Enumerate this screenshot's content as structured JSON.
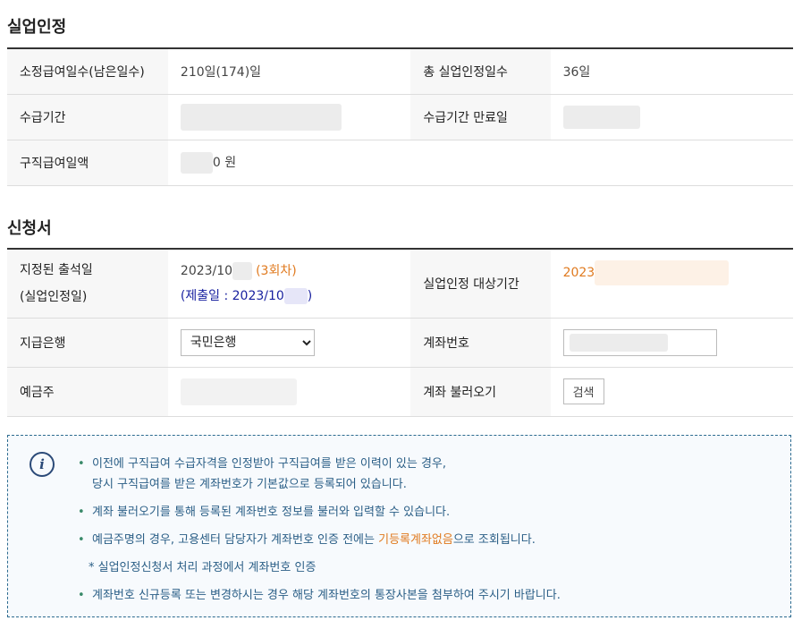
{
  "section1": {
    "title": "실업인정",
    "benefit_days_label": "소정급여일수(남은일수)",
    "benefit_days_value": "210일(174)일",
    "total_recognitions_label": "총 실업인정일수",
    "total_recognitions_value": "36일",
    "period_label": "수급기간",
    "period_end_label": "수급기간 만료일",
    "daily_amount_label": "구직급여일액",
    "daily_amount_suffix": "0 원"
  },
  "section2": {
    "title": "신청서",
    "attend_label_1": "지정된 출석일",
    "attend_label_2": "(실업인정일)",
    "attend_date": "2023/10",
    "attend_round": "(3회차)",
    "submit_prefix": "(제출일 : 2023/10",
    "submit_suffix": ")",
    "target_period_label": "실업인정 대상기간",
    "target_period_value": "2023",
    "bank_label": "지급은행",
    "bank_selected": "국민은행",
    "account_label": "계좌번호",
    "holder_label": "예금주",
    "fetch_label": "계좌 불러오기",
    "search_button": "검색"
  },
  "notice": {
    "icon": "info-icon",
    "line1a": "이전에 구직급여 수급자격을 인정받아 구직급여를 받은 이력이 있는 경우,",
    "line1b": "당시 구직급여를 받은 계좌번호가 기본값으로 등록되어 있습니다.",
    "line2": "계좌 불러오기를 통해 등록된 계좌번호 정보를 불러와 입력할 수 있습니다.",
    "line3_prefix": "예금주명의 경우, 고용센터 담당자가 계좌번호 인증 전에는 ",
    "line3_highlight": "기등록계좌없음",
    "line3_suffix": "으로 조회됩니다.",
    "line4": "* 실업인정신청서 처리 과정에서 계좌번호 인증",
    "line5": "계좌번호 신규등록 또는 변경하시는 경우 해당 계좌번호의 통장사본을 첨부하여 주시기 바랍니다.",
    "bullet": "•"
  }
}
